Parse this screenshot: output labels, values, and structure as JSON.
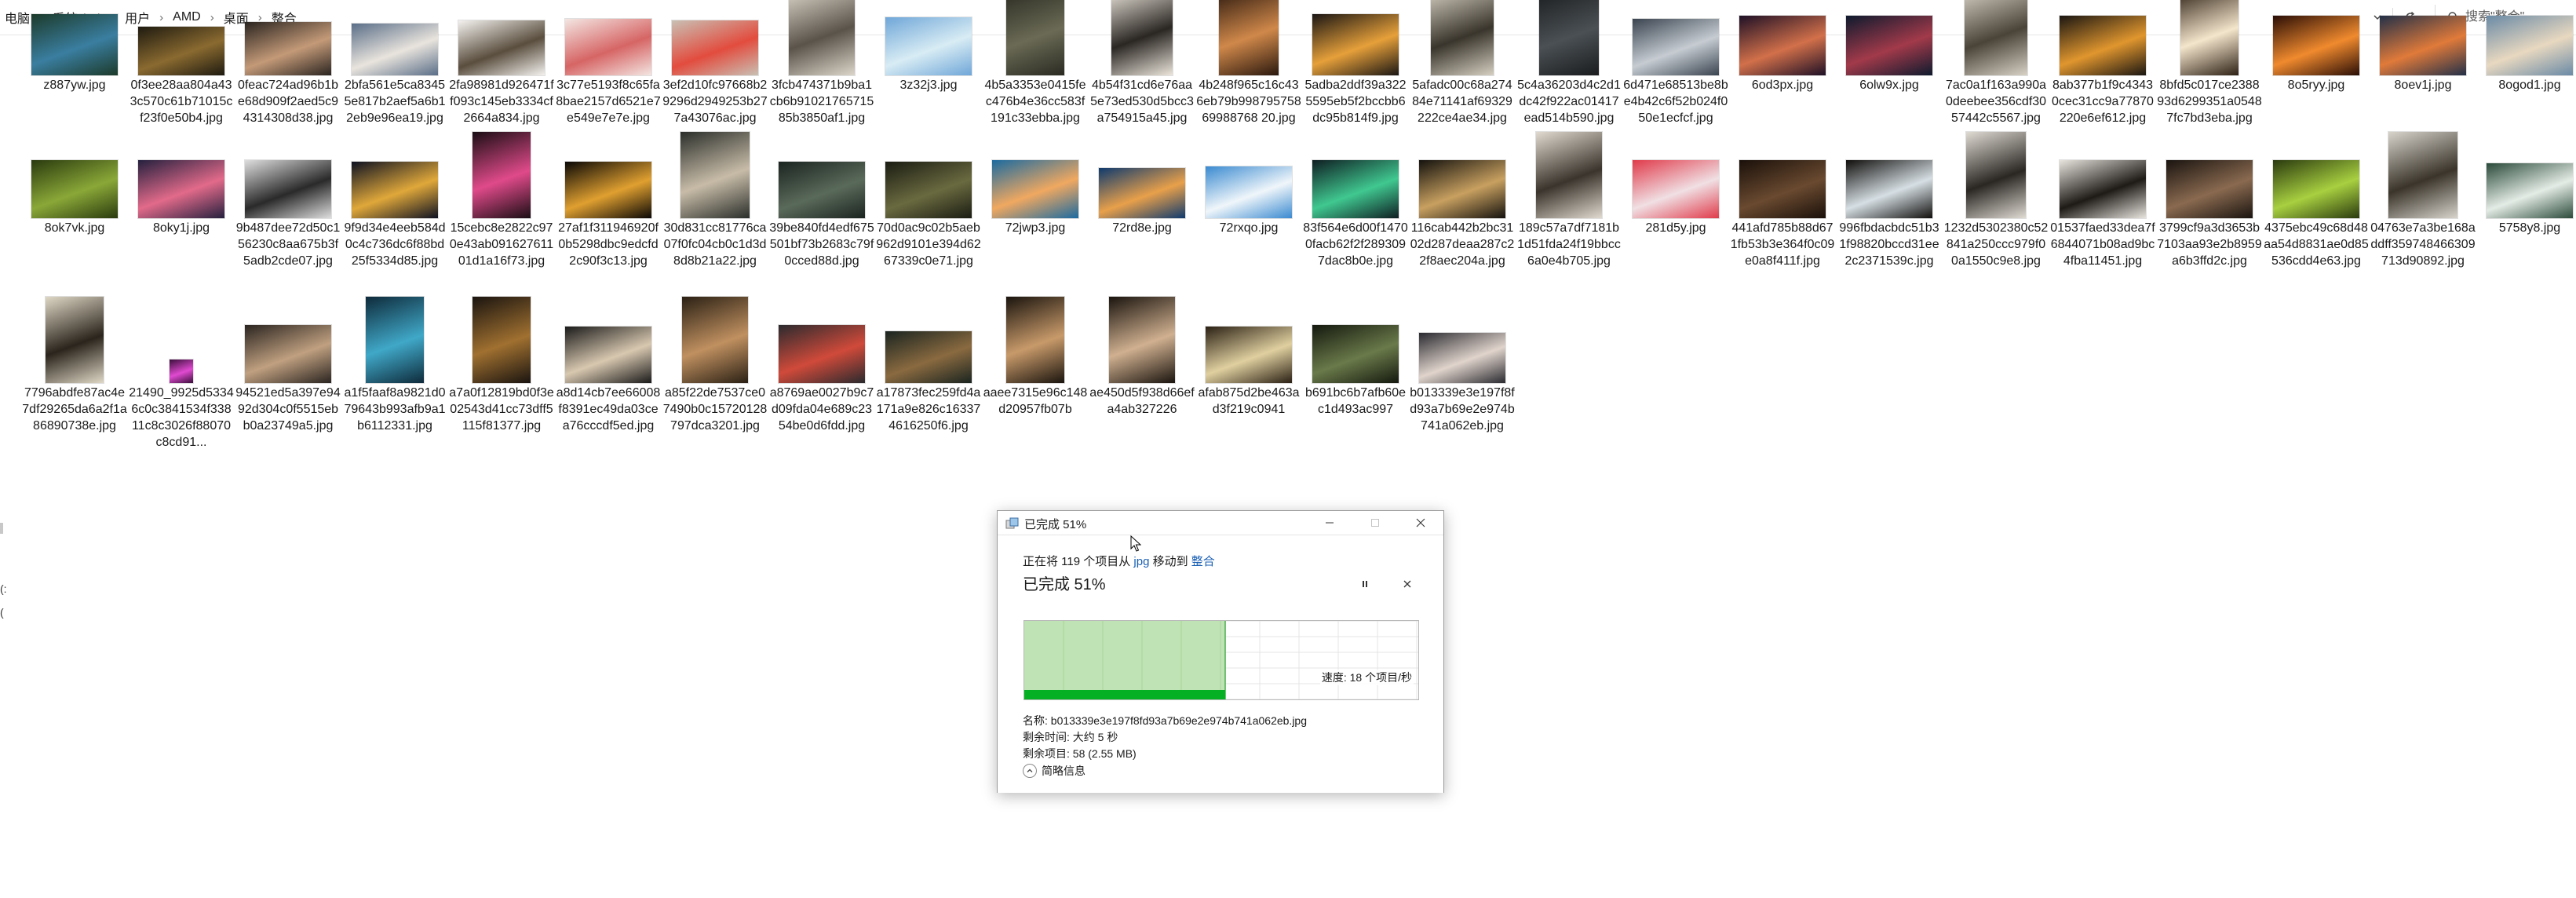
{
  "breadcrumb": [
    "电脑",
    "系统 (C:)",
    "用户",
    "AMD",
    "桌面",
    "整合"
  ],
  "search": {
    "placeholder": "搜索\"整合\""
  },
  "left_fragments": [
    "(:",
    "("
  ],
  "files": [
    {
      "name": "z887yw.jpg",
      "colors": [
        "#1c3a2a",
        "#3a7ea0"
      ],
      "w": 110,
      "h": 78
    },
    {
      "name": "0f3ee28aa804a433c570c61b71015cf23f0e50b4.jpg",
      "colors": [
        "#1e1a10",
        "#8a6a30"
      ],
      "w": 110,
      "h": 62
    },
    {
      "name": "0feac724ad96b1be68d909f2aed5c94314308d38.jpg",
      "colors": [
        "#2a2420",
        "#c49a78"
      ],
      "w": 110,
      "h": 68
    },
    {
      "name": "2bfa561e5ca83455e817b2aef5a6b12eb9e96ea19.jpg",
      "colors": [
        "#5a6e88",
        "#e9e4dd"
      ],
      "w": 110,
      "h": 66
    },
    {
      "name": "2fa98981d926471ff093c145eb3334cf2664a834.jpg",
      "colors": [
        "#f4f2ef",
        "#5a4e3e"
      ],
      "w": 110,
      "h": 70
    },
    {
      "name": "3c77e5193f8c65fa8bae2157d6521e7e549e7e7e.jpg",
      "colors": [
        "#f3e6e2",
        "#d66565"
      ],
      "w": 110,
      "h": 72
    },
    {
      "name": "3ef2d10fc97668b29296d2949253b277a43076ac.jpg",
      "colors": [
        "#c9c0b4",
        "#e24c3e"
      ],
      "w": 110,
      "h": 70
    },
    {
      "name": "3fcb474371b9ba1cb6b9102176571585b3850af1.jpg",
      "colors": [
        "#dcd6ca",
        "#5a534a"
      ],
      "w": 84,
      "h": 110
    },
    {
      "name": "3z32j3.jpg",
      "colors": [
        "#6fa6d8",
        "#d8ecf4"
      ],
      "w": 110,
      "h": 74
    },
    {
      "name": "4b5a3353e0415fec476b4e36cc583f191c33ebba.jpg",
      "colors": [
        "#2a2a22",
        "#6a6a55"
      ],
      "w": 74,
      "h": 110
    },
    {
      "name": "4b54f31cd6e76aa5e73ed530d5bcc3a754915a45.jpg",
      "colors": [
        "#ece6dc",
        "#2a2622"
      ],
      "w": 78,
      "h": 110
    },
    {
      "name": "4b248f965c16c436eb79b99879575869988768 20.jpg",
      "colors": [
        "#2a180e",
        "#d0884a"
      ],
      "w": 76,
      "h": 110
    },
    {
      "name": "5adba2ddf39a3225595eb5f2bccbb6dc95b814f9.jpg",
      "colors": [
        "#1a1614",
        "#e6a03a"
      ],
      "w": 110,
      "h": 78
    },
    {
      "name": "5afadc00c68a27484e71141af69329222ce4ae34.jpg",
      "colors": [
        "#d6d0c2",
        "#3a352c"
      ],
      "w": 80,
      "h": 110
    },
    {
      "name": "5c4a36203d4c2d1dc42f922ac01417ead514b590.jpg",
      "colors": [
        "#1a1c1e",
        "#4a5054"
      ],
      "w": 76,
      "h": 110
    },
    {
      "name": "6d471e68513be8be4b42c6f52b024f050e1ecfcf.jpg",
      "colors": [
        "#3a4450",
        "#c6ccd2"
      ],
      "w": 110,
      "h": 72
    },
    {
      "name": "6od3px.jpg",
      "colors": [
        "#1e1026",
        "#d2704a"
      ],
      "w": 110,
      "h": 76
    },
    {
      "name": "6olw9x.jpg",
      "colors": [
        "#0e1a2e",
        "#a23a4a"
      ],
      "w": 110,
      "h": 76
    },
    {
      "name": "7ac0a1f163a990a0deebee356cdf3057442c5567.jpg",
      "colors": [
        "#d8d2c6",
        "#4a4438"
      ],
      "w": 80,
      "h": 110
    },
    {
      "name": "8ab377b1f9c43430cec31cc9a77870220e6ef612.jpg",
      "colors": [
        "#1a1612",
        "#e0962e"
      ],
      "w": 110,
      "h": 76
    },
    {
      "name": "8bfd5c017ce238893d6299351a05487fc7bd3eba.jpg",
      "colors": [
        "#2e2014",
        "#f4e6cc"
      ],
      "w": 74,
      "h": 110
    },
    {
      "name": "8o5ryy.jpg",
      "colors": [
        "#2a0e06",
        "#f08a2e"
      ],
      "w": 110,
      "h": 76
    },
    {
      "name": "8oev1j.jpg",
      "colors": [
        "#223048",
        "#e07a3a"
      ],
      "w": 110,
      "h": 76
    },
    {
      "name": "8ogod1.jpg",
      "colors": [
        "#6a8aa6",
        "#e8d8c0"
      ],
      "w": 110,
      "h": 76
    },
    {
      "name": "8ok7vk.jpg",
      "colors": [
        "#2a3a0e",
        "#8aa838"
      ],
      "w": 110,
      "h": 74
    },
    {
      "name": "8oky1j.jpg",
      "colors": [
        "#24203e",
        "#e26a8a"
      ],
      "w": 110,
      "h": 74
    },
    {
      "name": "9b487dee72d50c156230c8aa675b3f5adb2cde07.jpg",
      "colors": [
        "#dedede",
        "#2a2a2a"
      ],
      "w": 110,
      "h": 74
    },
    {
      "name": "9f9d34e4eeb584d0c4c736dc6f88bd25f5334d85.jpg",
      "colors": [
        "#0e1222",
        "#e0a83a"
      ],
      "w": 110,
      "h": 72
    },
    {
      "name": "15cebc8e2822c970e43ab09162761101d1a16f73.jpg",
      "colors": [
        "#1a0e14",
        "#e04a8a"
      ],
      "w": 74,
      "h": 110
    },
    {
      "name": "27af1f311946920f0b5298dbc9edcfd2c90f3c13.jpg",
      "colors": [
        "#0a0806",
        "#e0a030"
      ],
      "w": 110,
      "h": 72
    },
    {
      "name": "30d831cc81776ca07f0fc04cb0c1d3d8d8b21a22.jpg",
      "colors": [
        "#2a2e2a",
        "#c8bca8"
      ],
      "w": 88,
      "h": 110
    },
    {
      "name": "39be840fd4edf675501bf73b2683c79f0cced88d.jpg",
      "colors": [
        "#1a2420",
        "#5a6a5a"
      ],
      "w": 110,
      "h": 72
    },
    {
      "name": "70d0ac9c02b5aeb962d9101e394d6267339c0e71.jpg",
      "colors": [
        "#1a1c12",
        "#6a6a40"
      ],
      "w": 110,
      "h": 72
    },
    {
      "name": "72jwp3.jpg",
      "colors": [
        "#1a6aa0",
        "#f0a860"
      ],
      "w": 110,
      "h": 74
    },
    {
      "name": "72rd8e.jpg",
      "colors": [
        "#0e3a6e",
        "#e8a04a"
      ],
      "w": 110,
      "h": 64
    },
    {
      "name": "72rxqo.jpg",
      "colors": [
        "#3a8ad0",
        "#f0f6fa"
      ],
      "w": 110,
      "h": 66
    },
    {
      "name": "83f564e6d00f14700facb62f2f2893097dac8b0e.jpg",
      "colors": [
        "#0e1e22",
        "#40c890"
      ],
      "w": 110,
      "h": 74
    },
    {
      "name": "116cab442b2bc3102d287deaa287c22f8aec204a.jpg",
      "colors": [
        "#14120e",
        "#c8a060"
      ],
      "w": 110,
      "h": 74
    },
    {
      "name": "189c57a7df7181b1d51fda24f19bbcc6a0e4b705.jpg",
      "colors": [
        "#e0dad0",
        "#3a342c"
      ],
      "w": 84,
      "h": 110
    },
    {
      "name": "281d5y.jpg",
      "colors": [
        "#e03a4a",
        "#f0e0e4"
      ],
      "w": 110,
      "h": 74
    },
    {
      "name": "441afd785b88d671fb53b3e364f0c09e0a8f411f.jpg",
      "colors": [
        "#1a100a",
        "#6a4a30"
      ],
      "w": 110,
      "h": 74
    },
    {
      "name": "996fbdacbdc51b31f98820bccd31ee2c2371539c.jpg",
      "colors": [
        "#100e0c",
        "#d6dfe4"
      ],
      "w": 110,
      "h": 74
    },
    {
      "name": "1232d5302380c52841a250ccc979f00a1550c9e8.jpg",
      "colors": [
        "#e0dcd4",
        "#2a2622"
      ],
      "w": 76,
      "h": 110
    },
    {
      "name": "01537faed33dea7f6844071b08ad9bc4fba11451.jpg",
      "colors": [
        "#e8e4de",
        "#1e1a16"
      ],
      "w": 110,
      "h": 74
    },
    {
      "name": "3799cf9a3d3653b7103aa93e2b8959a6b3ffd2c.jpg",
      "colors": [
        "#1a1410",
        "#8a6a50"
      ],
      "w": 110,
      "h": 74
    },
    {
      "name": "4375ebc49c68d48aa54d8831ae0d85536cdd4e63.jpg",
      "colors": [
        "#2a3a0e",
        "#a8d040"
      ],
      "w": 110,
      "h": 74
    },
    {
      "name": "04763e7a3be168addff359748466309713d90892.jpg",
      "colors": [
        "#d8d4cc",
        "#3a342a"
      ],
      "w": 88,
      "h": 110
    },
    {
      "name": "5758y8.jpg",
      "colors": [
        "#2a4a3a",
        "#e4ece6"
      ],
      "w": 110,
      "h": 70
    },
    {
      "name": "7796abdfe87ac4e7df29265da6a2f1a86890738e.jpg",
      "colors": [
        "#e0d8c6",
        "#2a241c"
      ],
      "w": 74,
      "h": 110
    },
    {
      "name": "21490_9925d53346c0c3841534f33811c8c3026f88070c8cd91...",
      "colors": [
        "#3a0e3a",
        "#e04ad0"
      ],
      "w": 30,
      "h": 30
    },
    {
      "name": "94521ed5a397e9492d304c0f5515ebb0a23749a5.jpg",
      "colors": [
        "#2a2420",
        "#c0a080"
      ],
      "w": 110,
      "h": 74
    },
    {
      "name": "a1f5faaf8a9821d079643b993afb9a1b6112331.jpg",
      "colors": [
        "#0e2a3a",
        "#40a8c8"
      ],
      "w": 74,
      "h": 110
    },
    {
      "name": "a7a0f12819bd0f3e02543d41cc73dff5115f81377.jpg",
      "colors": [
        "#1a1410",
        "#a07030"
      ],
      "w": 74,
      "h": 110
    },
    {
      "name": "a8d14cb7ee66008f8391ec49da03cea76cccdf5ed.jpg",
      "colors": [
        "#1a1a1a",
        "#d8c8b0"
      ],
      "w": 110,
      "h": 72
    },
    {
      "name": "a85f22de7537ce07490b0c15720128797dca3201.jpg",
      "colors": [
        "#2a2014",
        "#c09060"
      ],
      "w": 84,
      "h": 110
    },
    {
      "name": "a8769ae0027b9c7d09fda04e689c2354be0d6fdd.jpg",
      "colors": [
        "#2a2a2e",
        "#d04a3a"
      ],
      "w": 110,
      "h": 74
    },
    {
      "name": "a17873fec259fd4a171a9e826c163374616250f6.jpg",
      "colors": [
        "#1a2420",
        "#8a6a40"
      ],
      "w": 110,
      "h": 66
    },
    {
      "name": "aaee7315e96c148d20957fb07b",
      "colors": [
        "#1a140e",
        "#c89a6a"
      ],
      "w": 74,
      "h": 110
    },
    {
      "name": "ae450d5f938d66efa4ab327226",
      "colors": [
        "#1a140e",
        "#d0b090"
      ],
      "w": 84,
      "h": 110
    },
    {
      "name": "afab875d2be463ad3f219c0941",
      "colors": [
        "#2a2014",
        "#e0d0a0"
      ],
      "w": 110,
      "h": 72
    },
    {
      "name": "b691bc6b7afb60ec1d493ac997",
      "colors": [
        "#14180e",
        "#6a7a4a"
      ],
      "w": 110,
      "h": 74
    },
    {
      "name": "b013339e3e197f8fd93a7b69e2e974b741a062eb.jpg",
      "colors": [
        "#2a2a30",
        "#e0d4cc"
      ],
      "w": 110,
      "h": 64
    }
  ],
  "dialog": {
    "title": "已完成 51%",
    "moving_prefix": "正在将 119 个项目从 ",
    "src": "jpg",
    "moving_mid": " 移动到 ",
    "dest": "整合",
    "headline": "已完成 51%",
    "progress": 0.51,
    "speed": "速度: 18 个项目/秒",
    "name_line": "名称: b013339e3e197f8fd93a7b69e2e974b741a062eb.jpg",
    "remaining_time": "剩余时间: 大约 5 秒",
    "remaining_items": "剩余项目: 58 (2.55 MB)",
    "fewer_details": "简略信息"
  },
  "colors": {
    "progress_fill": "#bfe3b4",
    "progress_border": "#4caf50",
    "progress_bar": "#06b025"
  }
}
